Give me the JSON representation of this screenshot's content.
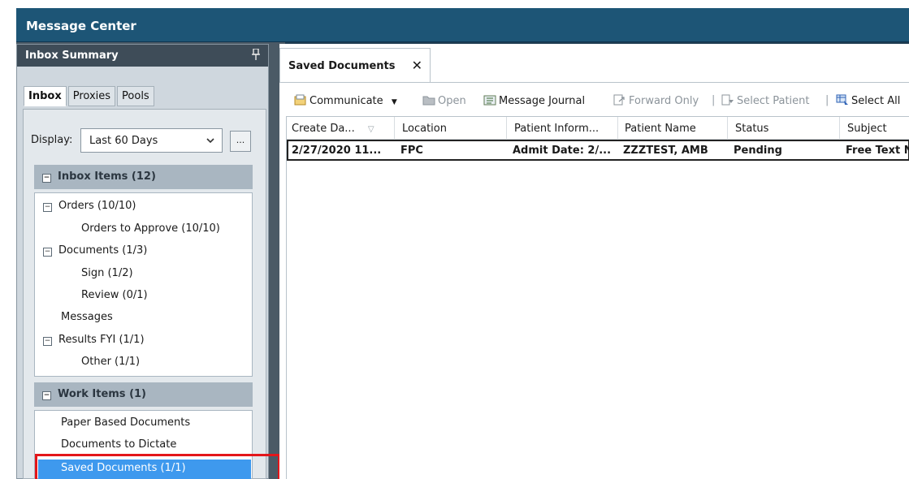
{
  "window": {
    "title": "Message Center"
  },
  "inbox_summary": {
    "title": "Inbox Summary",
    "tabs": [
      "Inbox",
      "Proxies",
      "Pools"
    ],
    "display_label": "Display:",
    "display_value": "Last 60 Days",
    "ellipsis_label": "...",
    "inbox_items": {
      "header": "Inbox Items (12)",
      "tree": [
        "Orders (10/10)",
        "Orders to Approve (10/10)",
        "Documents (1/3)",
        "Sign (1/2)",
        "Review (0/1)",
        "Messages",
        "Results FYI (1/1)",
        "Other (1/1)"
      ]
    },
    "work_items": {
      "header": "Work Items (1)",
      "items": [
        "Paper Based Documents",
        "Documents to Dictate",
        "Saved Documents (1/1)"
      ]
    }
  },
  "document_tab": {
    "label": "Saved Documents",
    "close": "✕"
  },
  "toolbar": {
    "communicate": "Communicate",
    "open": "Open",
    "message_journal": "Message Journal",
    "forward_only": "Forward Only",
    "select_patient": "Select Patient",
    "select_all": "Select All",
    "separator": "|"
  },
  "grid": {
    "columns": [
      "Create Da...",
      "Location",
      "Patient Inform...",
      "Patient Name",
      "Status",
      "Subject"
    ],
    "rows": [
      [
        "2/27/2020 11...",
        "FPC",
        "Admit Date: 2/...",
        "ZZZTEST, AMB",
        "Pending",
        "Free Text N"
      ]
    ]
  },
  "icons": {
    "pin": "pin-icon",
    "chevron": "chevron-down-icon",
    "collapse": "minus-box-icon",
    "close": "close-icon",
    "sort": "sort-arrow-icon"
  },
  "colors": {
    "title_bar": "#1d5576",
    "selection": "#3e99ee",
    "highlight_box": "#e3161a"
  }
}
